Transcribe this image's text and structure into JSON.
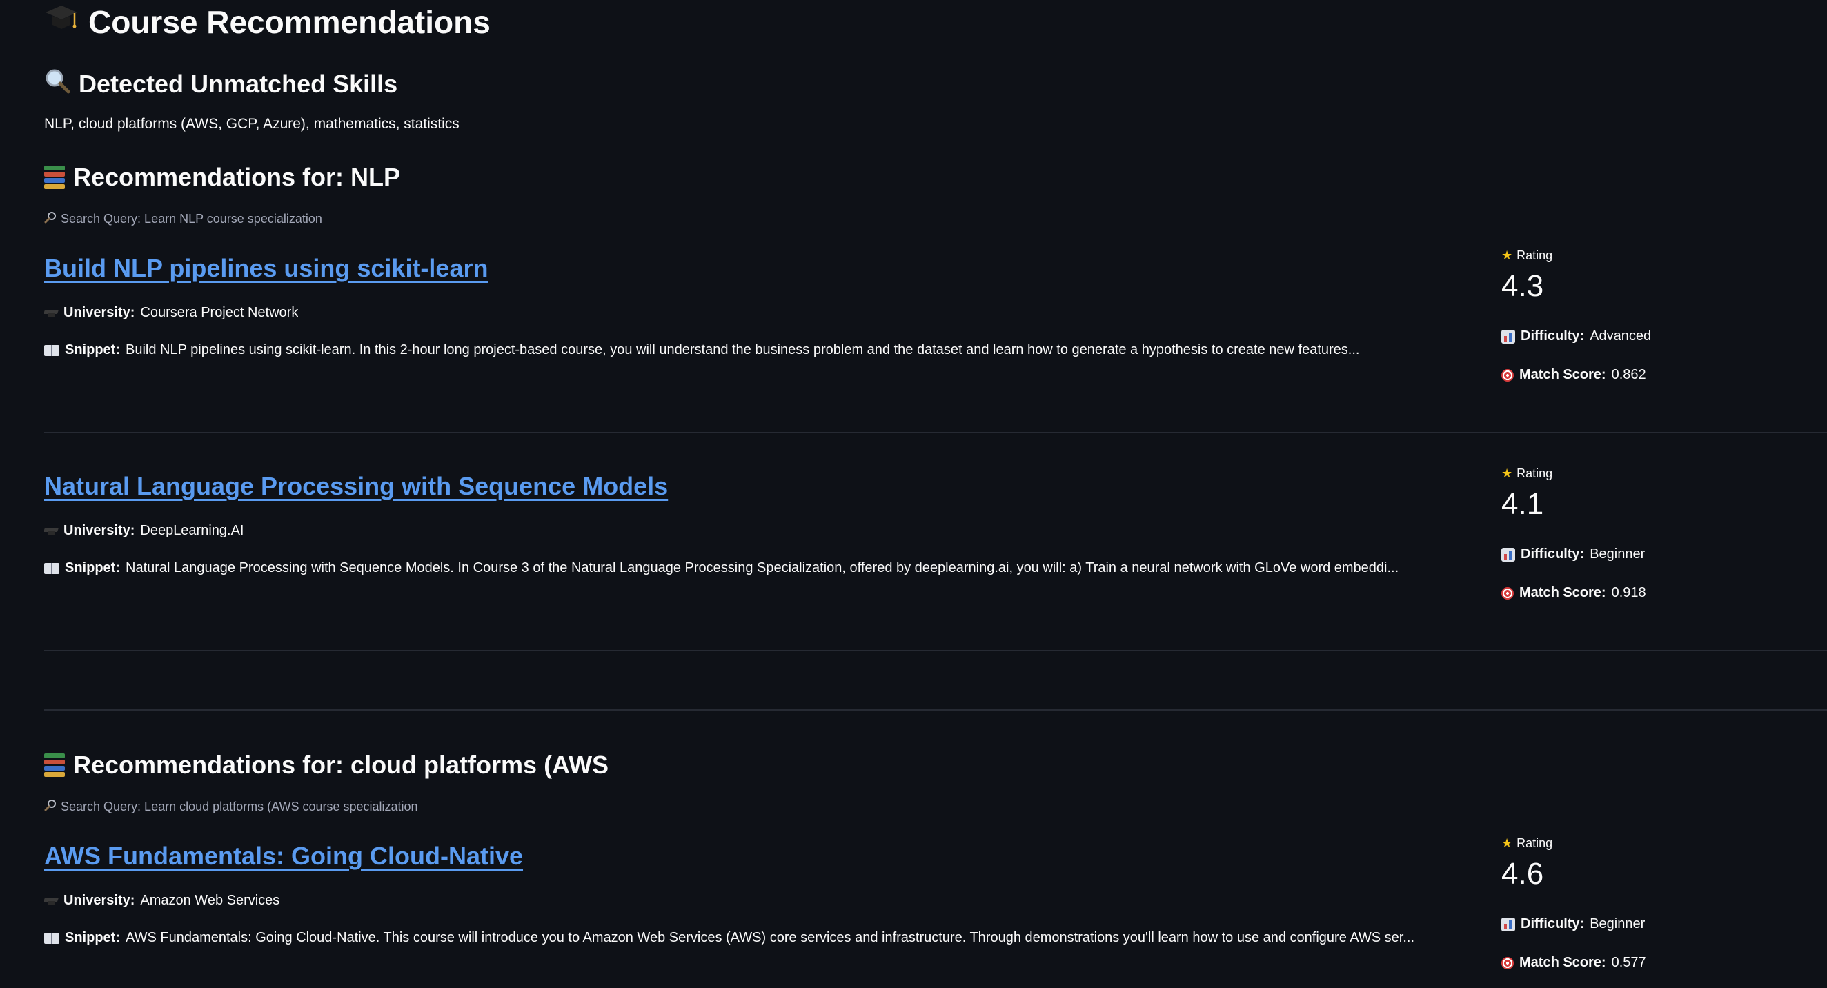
{
  "page": {
    "title_icon": "graduation-cap-icon",
    "title": "Course Recommendations"
  },
  "skills": {
    "heading_icon": "magnifying-glass-icon",
    "heading": "Detected Unmatched Skills",
    "text": "NLP, cloud platforms (AWS, GCP, Azure), mathematics, statistics"
  },
  "labels": {
    "university": "University:",
    "snippet": "Snippet:",
    "rating": "Rating",
    "difficulty": "Difficulty:",
    "match_score": "Match Score:"
  },
  "sections": [
    {
      "heading": "Recommendations for: NLP",
      "query": "Search Query: Learn NLP course specialization",
      "courses": [
        {
          "title": "Build NLP pipelines using scikit-learn",
          "university": "Coursera Project Network",
          "snippet": "Build NLP pipelines using scikit-learn. In this 2-hour long project-based course, you will understand the business problem and the dataset and learn how to generate a hypothesis to create new features...",
          "rating": "4.3",
          "difficulty": "Advanced",
          "match_score": "0.862"
        },
        {
          "title": "Natural Language Processing with Sequence Models",
          "university": "DeepLearning.AI",
          "snippet": "Natural Language Processing with Sequence Models. In Course 3 of the Natural Language Processing Specialization, offered by deeplearning.ai, you will: a) Train a neural network with GLoVe word embeddi...",
          "rating": "4.1",
          "difficulty": "Beginner",
          "match_score": "0.918"
        }
      ]
    },
    {
      "heading": "Recommendations for: cloud platforms (AWS",
      "query": "Search Query: Learn cloud platforms (AWS course specialization",
      "courses": [
        {
          "title": "AWS Fundamentals: Going Cloud-Native",
          "university": "Amazon Web Services",
          "snippet": "AWS Fundamentals: Going Cloud-Native. This course will introduce you to Amazon Web Services (AWS) core services and infrastructure. Through demonstrations you'll learn how to use and configure AWS ser...",
          "rating": "4.6",
          "difficulty": "Beginner",
          "match_score": "0.577"
        }
      ]
    }
  ]
}
